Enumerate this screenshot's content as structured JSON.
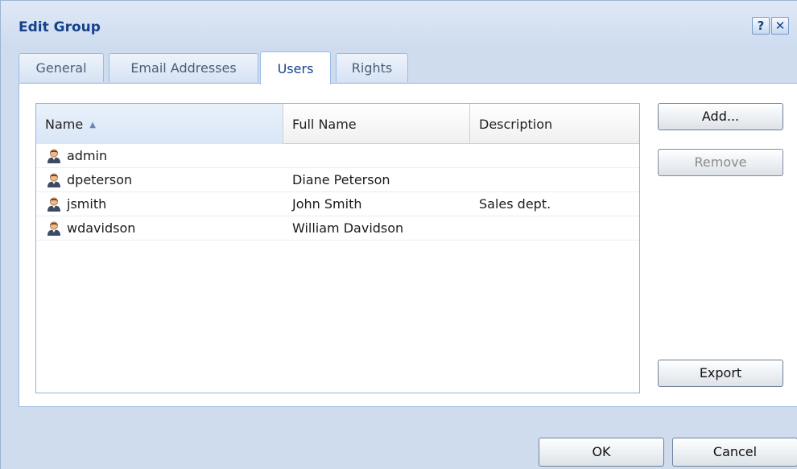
{
  "dialog": {
    "title": "Edit Group",
    "help_glyph": "?",
    "close_glyph": "✕",
    "icons": [
      "help-icon",
      "close-icon",
      "user-icon",
      "sort-ascending-icon"
    ]
  },
  "tabs": [
    {
      "label": "General",
      "active": false
    },
    {
      "label": "Email Addresses",
      "active": false
    },
    {
      "label": "Users",
      "active": true
    },
    {
      "label": "Rights",
      "active": false
    }
  ],
  "grid": {
    "columns": [
      {
        "label": "Name",
        "sort": "ascending"
      },
      {
        "label": "Full Name"
      },
      {
        "label": "Description"
      }
    ],
    "rows": [
      {
        "name": "admin",
        "full_name": "",
        "description": ""
      },
      {
        "name": "dpeterson",
        "full_name": "Diane Peterson",
        "description": ""
      },
      {
        "name": "jsmith",
        "full_name": "John Smith",
        "description": "Sales dept."
      },
      {
        "name": "wdavidson",
        "full_name": "William Davidson",
        "description": ""
      }
    ]
  },
  "buttons": {
    "add": "Add...",
    "remove": "Remove",
    "export": "Export",
    "ok": "OK",
    "cancel": "Cancel"
  },
  "colors": {
    "title_text": "#15428b",
    "dialog_background": "#cfdcee",
    "tab_border": "#99bbe8",
    "user_icon_head": "#f0b98a",
    "user_icon_body": "#3c4a63"
  }
}
